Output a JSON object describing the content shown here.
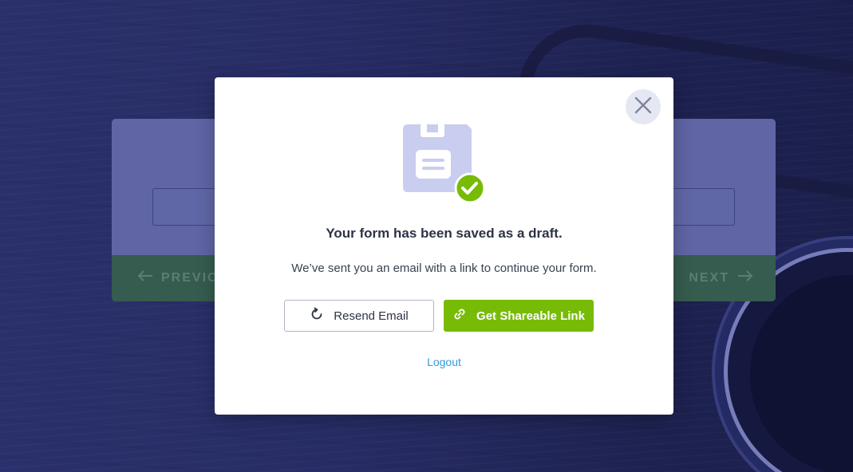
{
  "colors": {
    "backdrop": "#272b63",
    "form_card": "#6e75b6",
    "form_footer": "#3b6a4c",
    "accent_green": "#78bb07",
    "link_blue": "#2f9be0",
    "icon_lavender": "#c9cdef"
  },
  "form": {
    "prev_label": "PREVIO",
    "next_label": "NEXT",
    "prev_icon": "arrow-left-icon",
    "next_icon": "arrow-right-icon"
  },
  "modal": {
    "close_icon": "close-icon",
    "hero_icon": "saved-draft-icon",
    "title": "Your form has been saved as a draft.",
    "message": "We’ve sent you an email with a link to continue your form.",
    "resend_button": {
      "label": "Resend Email",
      "icon": "refresh-icon"
    },
    "share_button": {
      "label": "Get Shareable Link",
      "icon": "link-icon"
    },
    "logout_label": "Logout"
  }
}
